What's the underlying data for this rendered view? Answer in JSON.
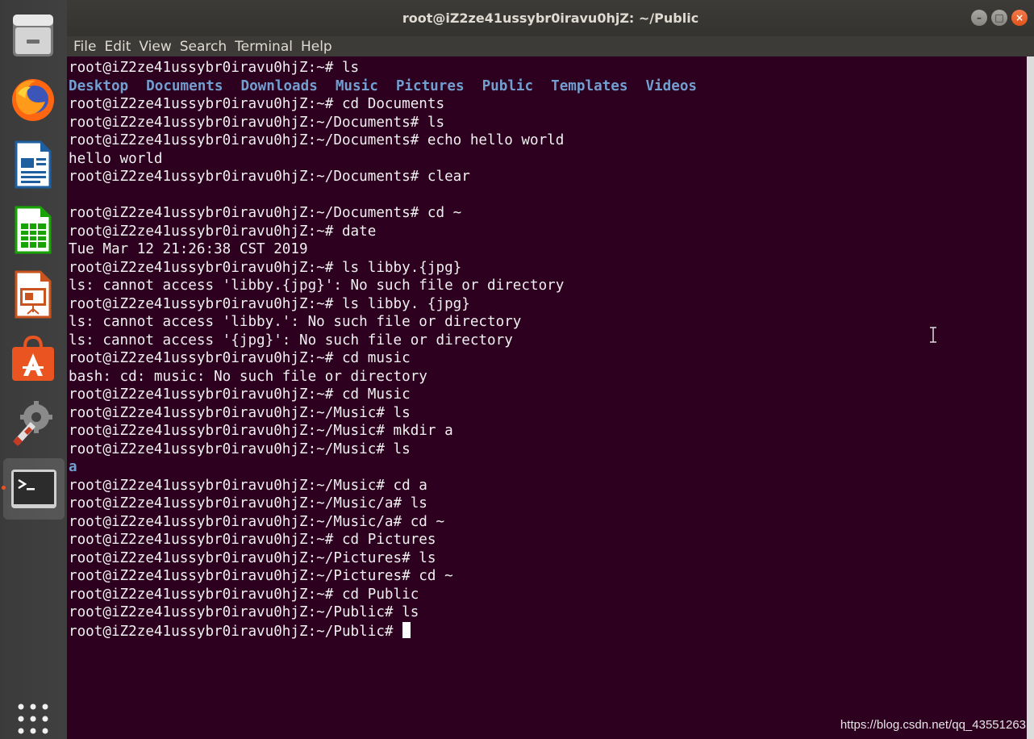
{
  "window": {
    "title": "root@iZ2ze41ussybr0iravu0hjZ: ~/Public",
    "controls": {
      "minimize": "–",
      "maximize": "□",
      "close": "×"
    }
  },
  "menu": [
    "File",
    "Edit",
    "View",
    "Search",
    "Terminal",
    "Help"
  ],
  "dock": {
    "items": [
      "files-icon",
      "firefox-icon",
      "writer-icon",
      "calc-icon",
      "impress-icon",
      "software-center-icon",
      "settings-icon",
      "terminal-icon"
    ],
    "apps_grid": "show-applications-icon"
  },
  "terminal": {
    "lines": [
      {
        "type": "text",
        "text": "root@iZ2ze41ussybr0iravu0hjZ:~# ls"
      },
      {
        "type": "dirs",
        "items": [
          "Desktop",
          "Documents",
          "Downloads",
          "Music",
          "Pictures",
          "Public",
          "Templates",
          "Videos"
        ]
      },
      {
        "type": "text",
        "text": "root@iZ2ze41ussybr0iravu0hjZ:~# cd Documents"
      },
      {
        "type": "text",
        "text": "root@iZ2ze41ussybr0iravu0hjZ:~/Documents# ls"
      },
      {
        "type": "text",
        "text": "root@iZ2ze41ussybr0iravu0hjZ:~/Documents# echo hello world"
      },
      {
        "type": "text",
        "text": "hello world"
      },
      {
        "type": "text",
        "text": "root@iZ2ze41ussybr0iravu0hjZ:~/Documents# clear"
      },
      {
        "type": "text",
        "text": ""
      },
      {
        "type": "text",
        "text": "root@iZ2ze41ussybr0iravu0hjZ:~/Documents# cd ~"
      },
      {
        "type": "text",
        "text": "root@iZ2ze41ussybr0iravu0hjZ:~# date"
      },
      {
        "type": "text",
        "text": "Tue Mar 12 21:26:38 CST 2019"
      },
      {
        "type": "text",
        "text": "root@iZ2ze41ussybr0iravu0hjZ:~# ls libby.{jpg}"
      },
      {
        "type": "text",
        "text": "ls: cannot access 'libby.{jpg}': No such file or directory"
      },
      {
        "type": "text",
        "text": "root@iZ2ze41ussybr0iravu0hjZ:~# ls libby. {jpg}"
      },
      {
        "type": "text",
        "text": "ls: cannot access 'libby.': No such file or directory"
      },
      {
        "type": "text",
        "text": "ls: cannot access '{jpg}': No such file or directory"
      },
      {
        "type": "text",
        "text": "root@iZ2ze41ussybr0iravu0hjZ:~# cd music"
      },
      {
        "type": "text",
        "text": "bash: cd: music: No such file or directory"
      },
      {
        "type": "text",
        "text": "root@iZ2ze41ussybr0iravu0hjZ:~# cd Music"
      },
      {
        "type": "text",
        "text": "root@iZ2ze41ussybr0iravu0hjZ:~/Music# ls"
      },
      {
        "type": "text",
        "text": "root@iZ2ze41ussybr0iravu0hjZ:~/Music# mkdir a"
      },
      {
        "type": "text",
        "text": "root@iZ2ze41ussybr0iravu0hjZ:~/Music# ls"
      },
      {
        "type": "dirs",
        "items": [
          "a"
        ]
      },
      {
        "type": "text",
        "text": "root@iZ2ze41ussybr0iravu0hjZ:~/Music# cd a"
      },
      {
        "type": "text",
        "text": "root@iZ2ze41ussybr0iravu0hjZ:~/Music/a# ls"
      },
      {
        "type": "text",
        "text": "root@iZ2ze41ussybr0iravu0hjZ:~/Music/a# cd ~"
      },
      {
        "type": "text",
        "text": "root@iZ2ze41ussybr0iravu0hjZ:~# cd Pictures"
      },
      {
        "type": "text",
        "text": "root@iZ2ze41ussybr0iravu0hjZ:~/Pictures# ls"
      },
      {
        "type": "text",
        "text": "root@iZ2ze41ussybr0iravu0hjZ:~/Pictures# cd ~"
      },
      {
        "type": "text",
        "text": "root@iZ2ze41ussybr0iravu0hjZ:~# cd Public"
      },
      {
        "type": "text",
        "text": "root@iZ2ze41ussybr0iravu0hjZ:~/Public# ls"
      },
      {
        "type": "prompt",
        "text": "root@iZ2ze41ussybr0iravu0hjZ:~/Public# "
      }
    ]
  },
  "watermark": "https://blog.csdn.net/qq_43551263",
  "colors": {
    "terminal_bg": "#2c001e",
    "directory": "#729fcf",
    "accent": "#e95420"
  }
}
